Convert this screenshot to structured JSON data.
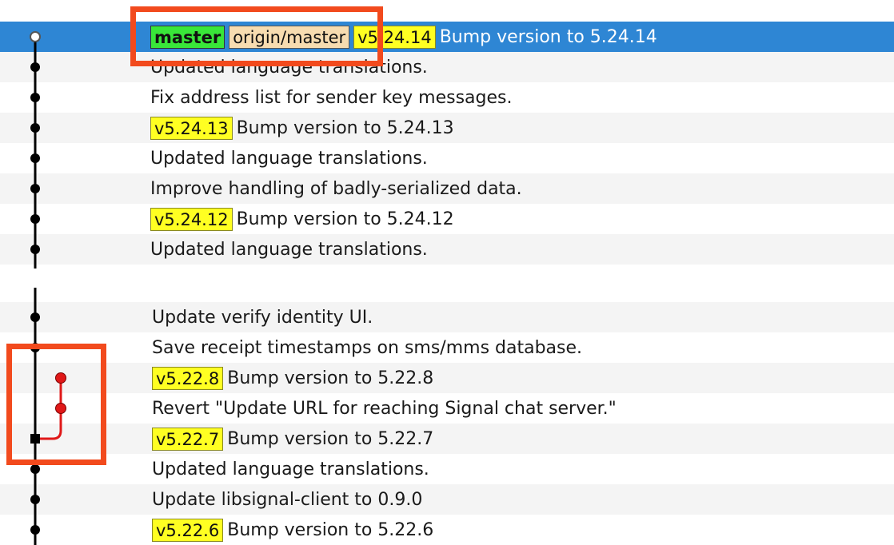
{
  "top_rows": [
    {
      "tags": [
        {
          "kind": "master",
          "text": "master"
        },
        {
          "kind": "origin",
          "text": "origin/master"
        },
        {
          "kind": "version",
          "text": "v5.24.14"
        }
      ],
      "message": "Bump version to 5.24.14",
      "selected": true
    },
    {
      "tags": [],
      "message": "Updated language translations."
    },
    {
      "tags": [],
      "message": "Fix address list for sender key messages."
    },
    {
      "tags": [
        {
          "kind": "version",
          "text": "v5.24.13"
        }
      ],
      "message": "Bump version to 5.24.13"
    },
    {
      "tags": [],
      "message": "Updated language translations."
    },
    {
      "tags": [],
      "message": "Improve handling of badly-serialized data."
    },
    {
      "tags": [
        {
          "kind": "version",
          "text": "v5.24.12"
        }
      ],
      "message": "Bump version to 5.24.12"
    },
    {
      "tags": [],
      "message": "Updated language translations."
    }
  ],
  "bottom_rows": [
    {
      "tags": [],
      "message": "Update verify identity UI."
    },
    {
      "tags": [],
      "message": "Save receipt timestamps on sms/mms database."
    },
    {
      "tags": [
        {
          "kind": "version",
          "text": "v5.22.8"
        }
      ],
      "message": "Bump version to 5.22.8"
    },
    {
      "tags": [],
      "message": "Revert \"Update URL for reaching Signal chat server.\""
    },
    {
      "tags": [
        {
          "kind": "version",
          "text": "v5.22.7"
        }
      ],
      "message": "Bump version to 5.22.7"
    },
    {
      "tags": [],
      "message": "Updated language translations."
    },
    {
      "tags": [],
      "message": "Update libsignal-client to 0.9.0"
    },
    {
      "tags": [
        {
          "kind": "version",
          "text": "v5.22.6"
        }
      ],
      "message": "Bump version to 5.22.6"
    }
  ],
  "colors": {
    "selection": "#2e86d4",
    "master_tag": "#39e639",
    "origin_tag": "#f7dcb0",
    "version_tag": "#ffff22",
    "graph_main": "#000000",
    "graph_branch": "#e01818",
    "highlight": "#f24a1d"
  },
  "icons": {
    "head_node": "hollow-circle-icon",
    "commit_node": "filled-circle-icon",
    "branch_node": "red-circle-icon",
    "merge_node": "square-node-icon"
  }
}
